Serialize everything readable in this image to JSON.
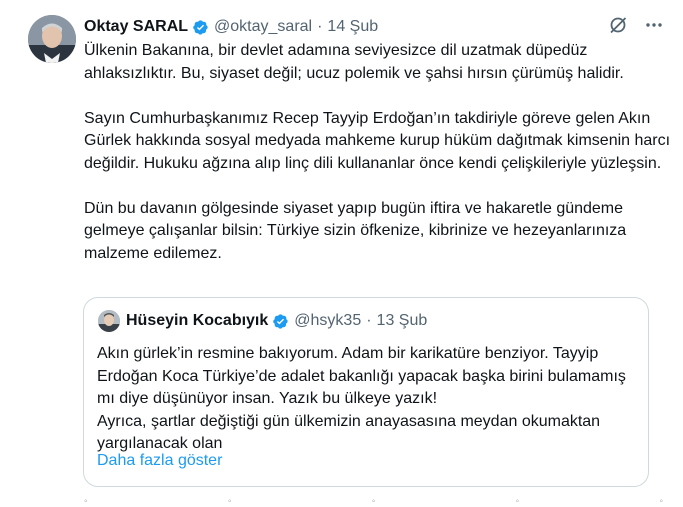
{
  "tweet": {
    "author_name": "Oktay SARAL",
    "author_handle": "@oktay_saral",
    "separator": "·",
    "date": "14 Şub",
    "body": "Ülkenin Bakanına, bir devlet adamına seviyesizce dil uzatmak düpedüz ahlaksızlıktır. Bu, siyaset değil; ucuz polemik ve şahsi hırsın çürümüş halidir.\n\nSayın Cumhurbaşkanımız Recep Tayyip Erdoğan’ın takdiriyle göreve gelen Akın Gürlek hakkında sosyal medyada mahkeme kurup hüküm dağıtmak kimsenin harcı değildir. Hukuku ağzına alıp linç dili kullananlar önce kendi çelişkileriyle yüzleşsin.\n\nDün bu davanın gölgesinde siyaset yapıp bugün iftira ve hakaretle gündeme gelmeye çalışanlar bilsin: Türkiye sizin öfkenize, kibrinize ve hezeyanlarınıza malzeme edilemez.",
    "icons": {
      "grok": "grok-icon",
      "more": "more-icon",
      "verified": "verified-badge-icon"
    },
    "accent_color": "#1d9bf0"
  },
  "quote": {
    "author_name": "Hüseyin Kocabıyık",
    "author_handle": "@hsyk35",
    "separator": "·",
    "date": "13 Şub",
    "body": "Akın gürlek’in resmine bakıyorum. Adam bir karikatüre benziyor. Tayyip Erdoğan Koca Türkiye’de adalet bakanlığı yapacak başka birini bulamamış mı diye düşünüyor insan. Yazık bu ülkeye yazık!\nAyrıca, şartlar değiştiği gün ülkemizin anayasasına meydan okumaktan yargılanacak olan",
    "show_more": "Daha fazla göster"
  }
}
